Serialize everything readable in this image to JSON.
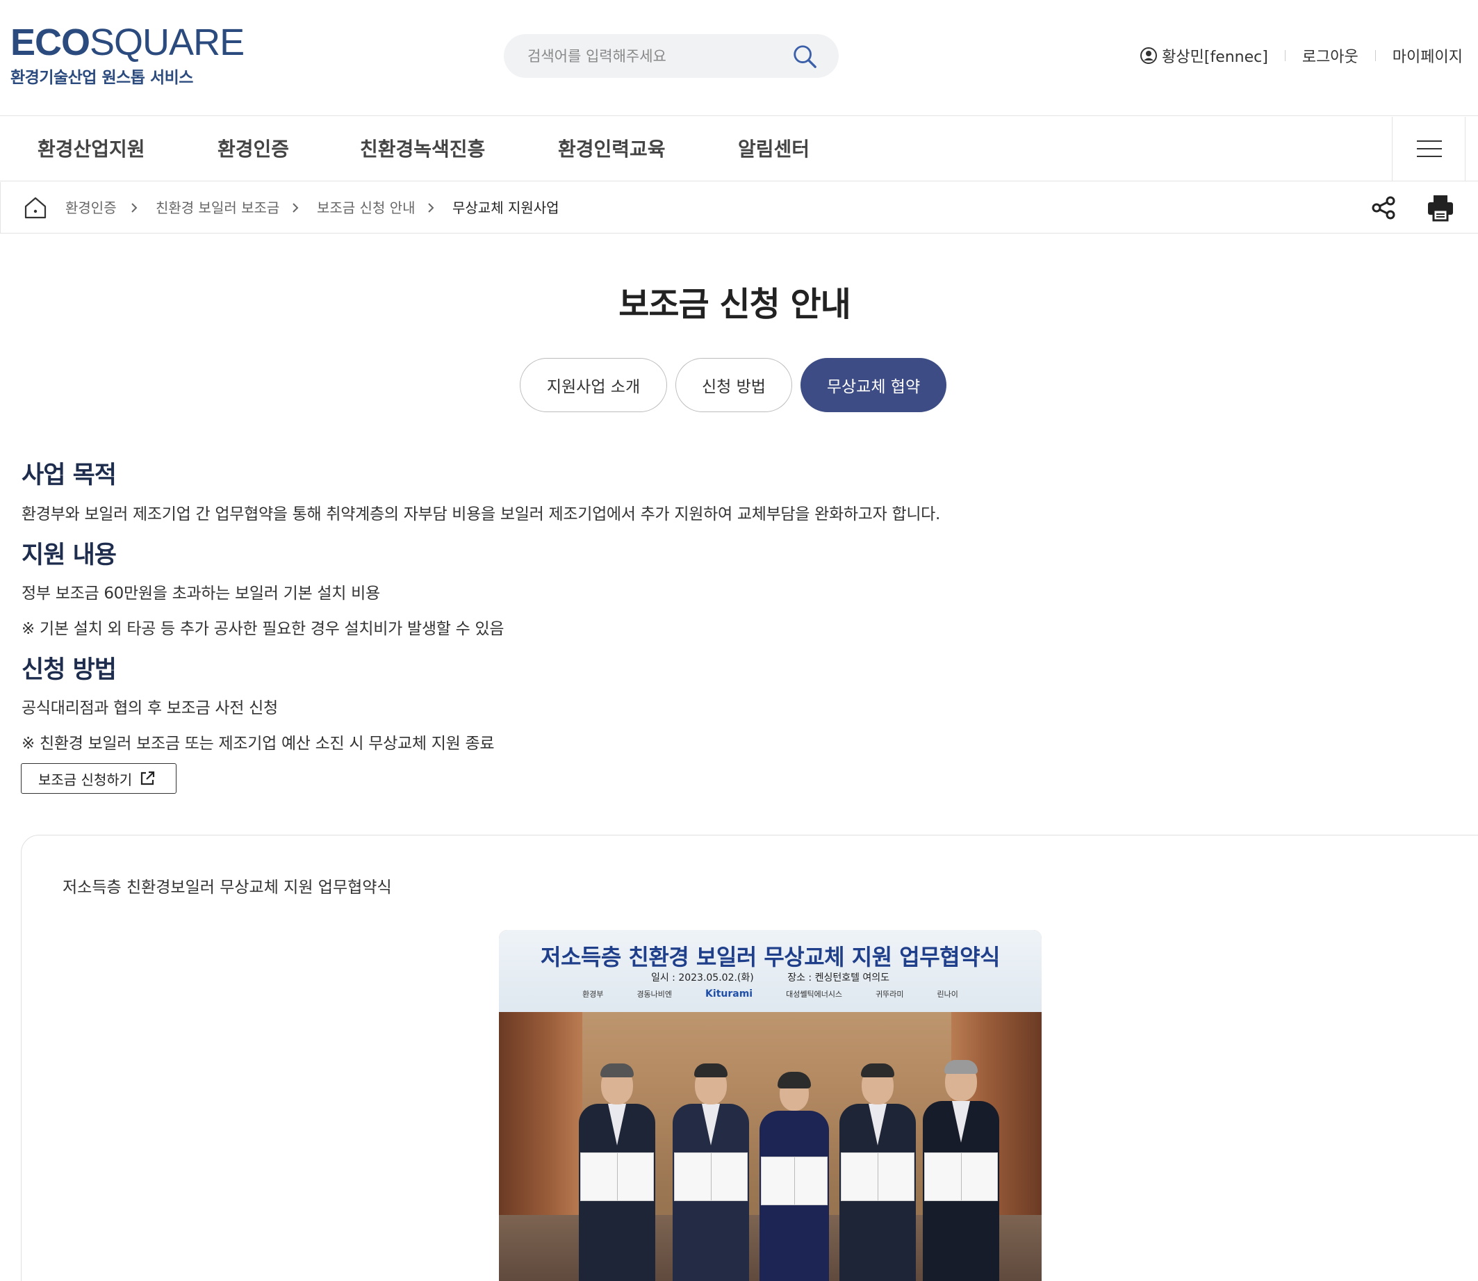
{
  "header": {
    "logo_bold": "ECO",
    "logo_light": "SQUARE",
    "logo_sub": "환경기술산업 원스톱 서비스",
    "search_placeholder": "검색어를 입력해주세요",
    "user_name": "황상민[fennec]",
    "logout_label": "로그아웃",
    "mypage_label": "마이페이지"
  },
  "gnb": {
    "items": [
      {
        "label": "환경산업지원"
      },
      {
        "label": "환경인증"
      },
      {
        "label": "친환경녹색진흥"
      },
      {
        "label": "환경인력교육"
      },
      {
        "label": "알림센터"
      }
    ]
  },
  "breadcrumb": {
    "items": [
      {
        "label": "환경인증"
      },
      {
        "label": "친환경 보일러 보조금"
      },
      {
        "label": "보조금 신청 안내"
      },
      {
        "label": "무상교체 지원사업"
      }
    ]
  },
  "page": {
    "title": "보조금 신청 안내",
    "tabs": [
      {
        "label": "지원사업 소개",
        "active": false
      },
      {
        "label": "신청 방법",
        "active": false
      },
      {
        "label": "무상교체 협약",
        "active": true
      }
    ]
  },
  "sections": {
    "purpose_title": "사업 목적",
    "purpose_text": "환경부와 보일러 제조기업 간 업무협약을 통해 취약계층의 자부담 비용을 보일러 제조기업에서 추가 지원하여 교체부담을 완화하고자 합니다.",
    "support_title": "지원 내용",
    "support_text": "정부 보조금 60만원을 초과하는 보일러 기본 설치 비용",
    "support_note": "※ 기본 설치 외 타공 등 추가 공사한 필요한 경우 설치비가 발생할 수 있음",
    "apply_title": "신청 방법",
    "apply_text": "공식대리점과 협의 후 보조금 사전 신청",
    "apply_note": "※ 친환경 보일러 보조금 또는 제조기업 예산 소진 시 무상교체 지원 종료",
    "apply_button": "보조금 신청하기"
  },
  "photo_card": {
    "caption": "저소득층 친환경보일러 무상교체 지원 업무협약식",
    "banner_title": "저소득층 친환경 보일러 무상교체 지원 업무협약식",
    "banner_date": "일시 : 2023.05.02.(화)",
    "banner_place": "장소 : 켄싱턴호텔 여의도",
    "banner_logos": [
      "환경부",
      "경동나비엔",
      "Kiturami",
      "대성쎌틱에너시스",
      "귀뚜라미",
      "린나이"
    ]
  },
  "colors": {
    "brand": "#2b4a7e",
    "tab_active": "#3d4c84",
    "section_title": "#1e2d4d"
  }
}
